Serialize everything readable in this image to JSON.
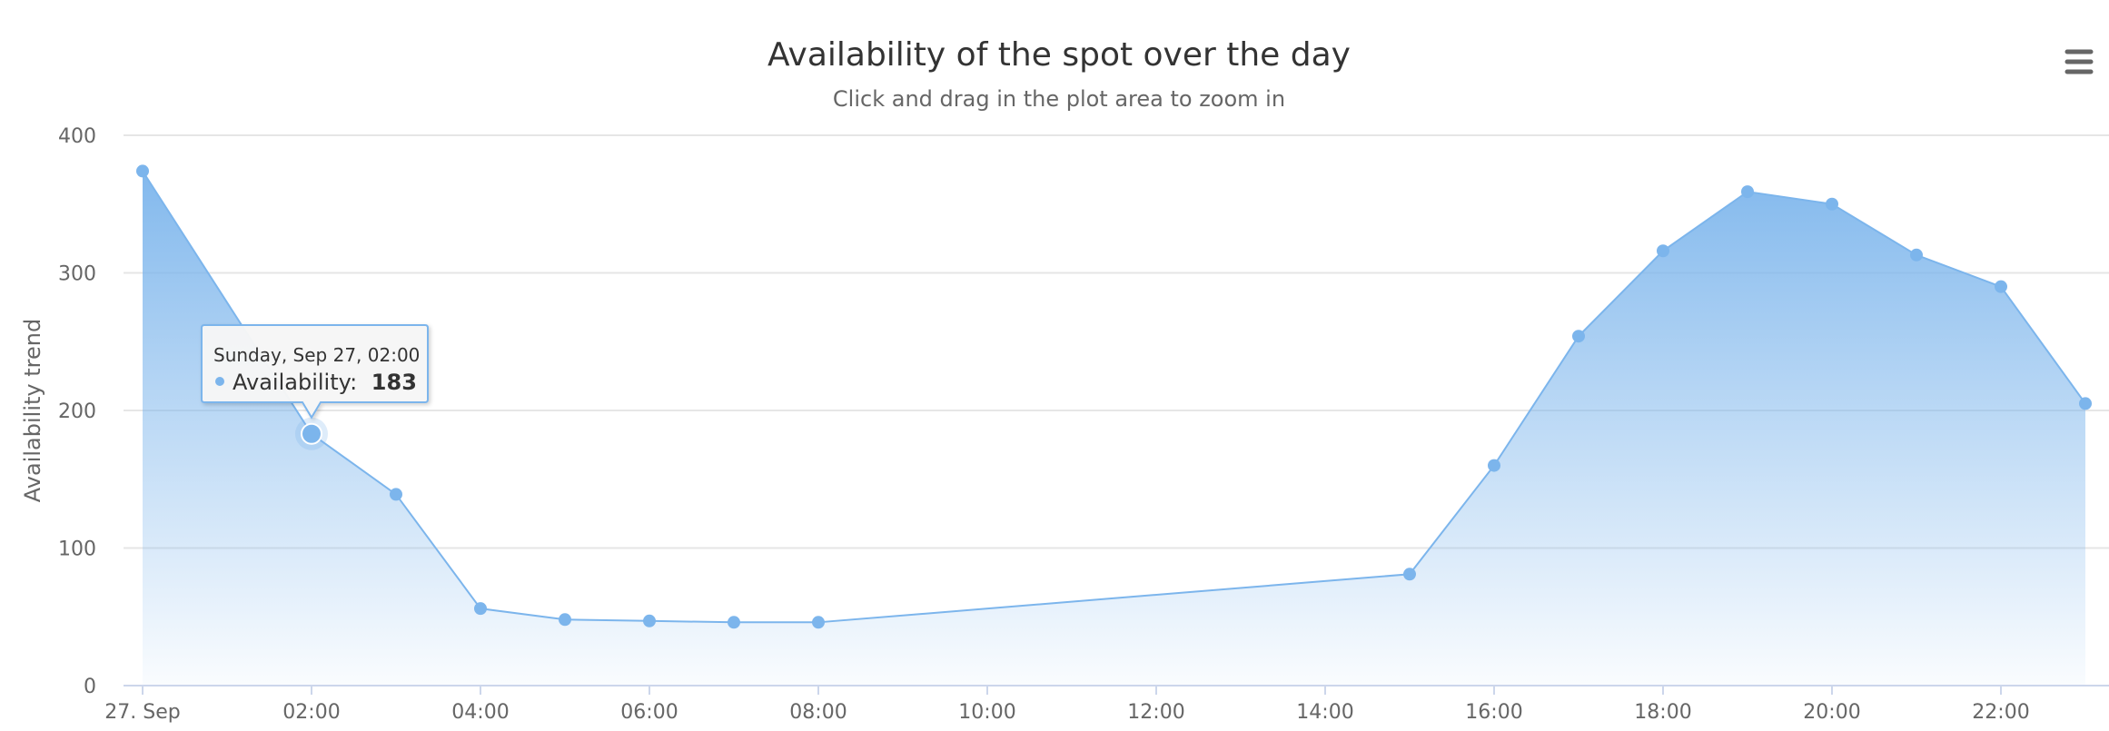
{
  "chart_data": {
    "type": "area",
    "title": "Availability of the spot over the day",
    "subtitle": "Click and drag in the plot area to zoom in",
    "xlabel": "",
    "ylabel": "Availability trend",
    "ylim": [
      0,
      400
    ],
    "y_ticks": [
      0,
      100,
      200,
      300,
      400
    ],
    "xlim": [
      0,
      23
    ],
    "x_ticks": [
      {
        "x": 0,
        "label": "27. Sep"
      },
      {
        "x": 2,
        "label": "02:00"
      },
      {
        "x": 4,
        "label": "04:00"
      },
      {
        "x": 6,
        "label": "06:00"
      },
      {
        "x": 8,
        "label": "08:00"
      },
      {
        "x": 10,
        "label": "10:00"
      },
      {
        "x": 12,
        "label": "12:00"
      },
      {
        "x": 14,
        "label": "14:00"
      },
      {
        "x": 16,
        "label": "16:00"
      },
      {
        "x": 18,
        "label": "18:00"
      },
      {
        "x": 20,
        "label": "20:00"
      },
      {
        "x": 22,
        "label": "22:00"
      }
    ],
    "grid": true,
    "legend": false,
    "series": [
      {
        "name": "Availability",
        "color": "#7cb5ec",
        "points": [
          {
            "x": 0,
            "y": 374
          },
          {
            "x": 2,
            "y": 183
          },
          {
            "x": 3,
            "y": 139
          },
          {
            "x": 4,
            "y": 56
          },
          {
            "x": 5,
            "y": 48
          },
          {
            "x": 6,
            "y": 47
          },
          {
            "x": 7,
            "y": 46
          },
          {
            "x": 8,
            "y": 46
          },
          {
            "x": 15,
            "y": 81
          },
          {
            "x": 16,
            "y": 160
          },
          {
            "x": 17,
            "y": 254
          },
          {
            "x": 18,
            "y": 316
          },
          {
            "x": 19,
            "y": 359
          },
          {
            "x": 20,
            "y": 350
          },
          {
            "x": 21,
            "y": 313
          },
          {
            "x": 22,
            "y": 290
          },
          {
            "x": 23,
            "y": 205
          }
        ]
      }
    ],
    "tooltip": {
      "point_index": 1,
      "header": "Sunday, Sep 27, 02:00",
      "series_label": "Availability:",
      "value": "183"
    }
  },
  "toolbar": {
    "menu_icon": "hamburger-menu-icon"
  },
  "colors": {
    "series": "#7cb5ec",
    "gridline": "#e6e6e6",
    "axis_line": "#ccd6eb",
    "title_text": "#333333",
    "subtitle_text": "#666666",
    "axis_text": "#666666",
    "tooltip_border": "#7cb5ec",
    "tooltip_bg": "#f7f7f7"
  }
}
